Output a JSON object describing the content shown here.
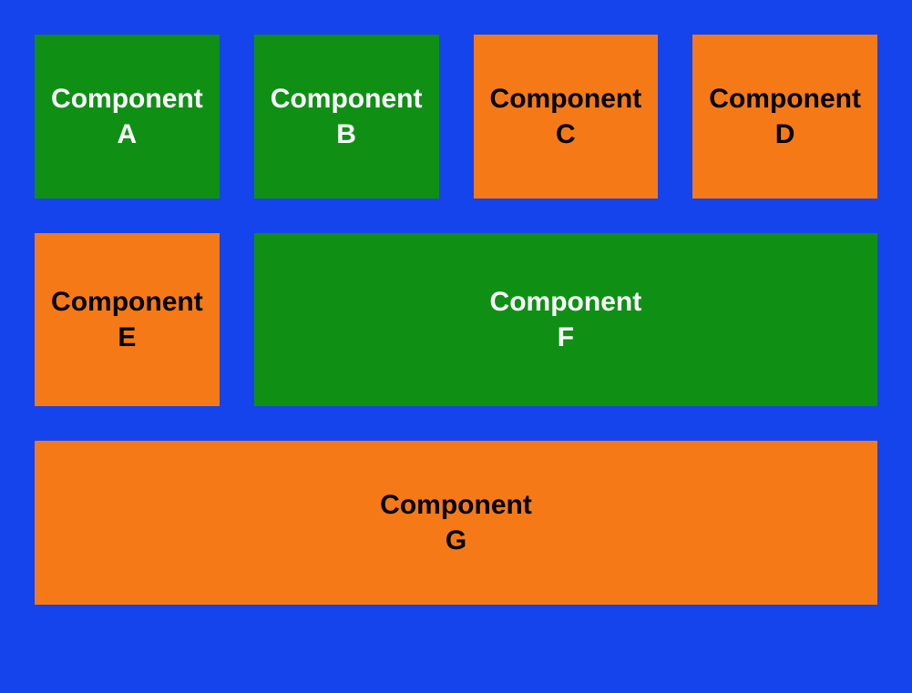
{
  "components": {
    "a": {
      "label": "Component\nA",
      "variant": "green"
    },
    "b": {
      "label": "Component\nB",
      "variant": "green"
    },
    "c": {
      "label": "Component\nC",
      "variant": "orange"
    },
    "d": {
      "label": "Component\nD",
      "variant": "orange"
    },
    "e": {
      "label": "Component\nE",
      "variant": "orange"
    },
    "f": {
      "label": "Component\nF",
      "variant": "green"
    },
    "g": {
      "label": "Component\nG",
      "variant": "orange"
    }
  },
  "colors": {
    "background": "#1544ed",
    "green": "#0f9015",
    "orange": "#f57a17"
  }
}
